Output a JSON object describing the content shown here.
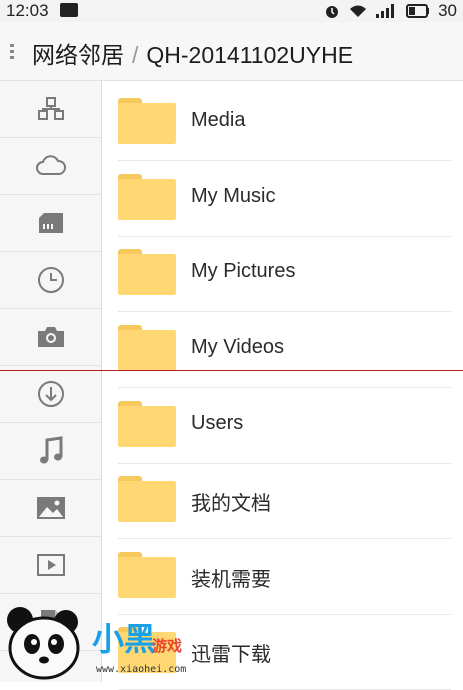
{
  "status_bar": {
    "time": "12:03",
    "battery": "30"
  },
  "header": {
    "location": "网络邻居",
    "separator": "/",
    "host": "QH-20141102UYHE"
  },
  "sidebar": {
    "items": [
      {
        "icon": "network-icon"
      },
      {
        "icon": "cloud-icon"
      },
      {
        "icon": "storage-icon"
      },
      {
        "icon": "clock-icon"
      },
      {
        "icon": "camera-icon"
      },
      {
        "icon": "download-icon"
      },
      {
        "icon": "music-icon"
      },
      {
        "icon": "image-icon"
      },
      {
        "icon": "video-icon"
      },
      {
        "icon": "document-icon"
      }
    ]
  },
  "folders": [
    {
      "label": "Media"
    },
    {
      "label": "My Music"
    },
    {
      "label": "My Pictures"
    },
    {
      "label": "My Videos"
    },
    {
      "label": "Users"
    },
    {
      "label": "我的文档"
    },
    {
      "label": "装机需要"
    },
    {
      "label": "迅雷下载"
    }
  ],
  "watermark": {
    "brand": "小黑",
    "sub": "游戏",
    "url": "www.xiaohei.com"
  },
  "colors": {
    "folder": "#ffd874",
    "folder_tab": "#f6c95d",
    "divider": "#b52020",
    "icon": "#7a7a7a"
  }
}
